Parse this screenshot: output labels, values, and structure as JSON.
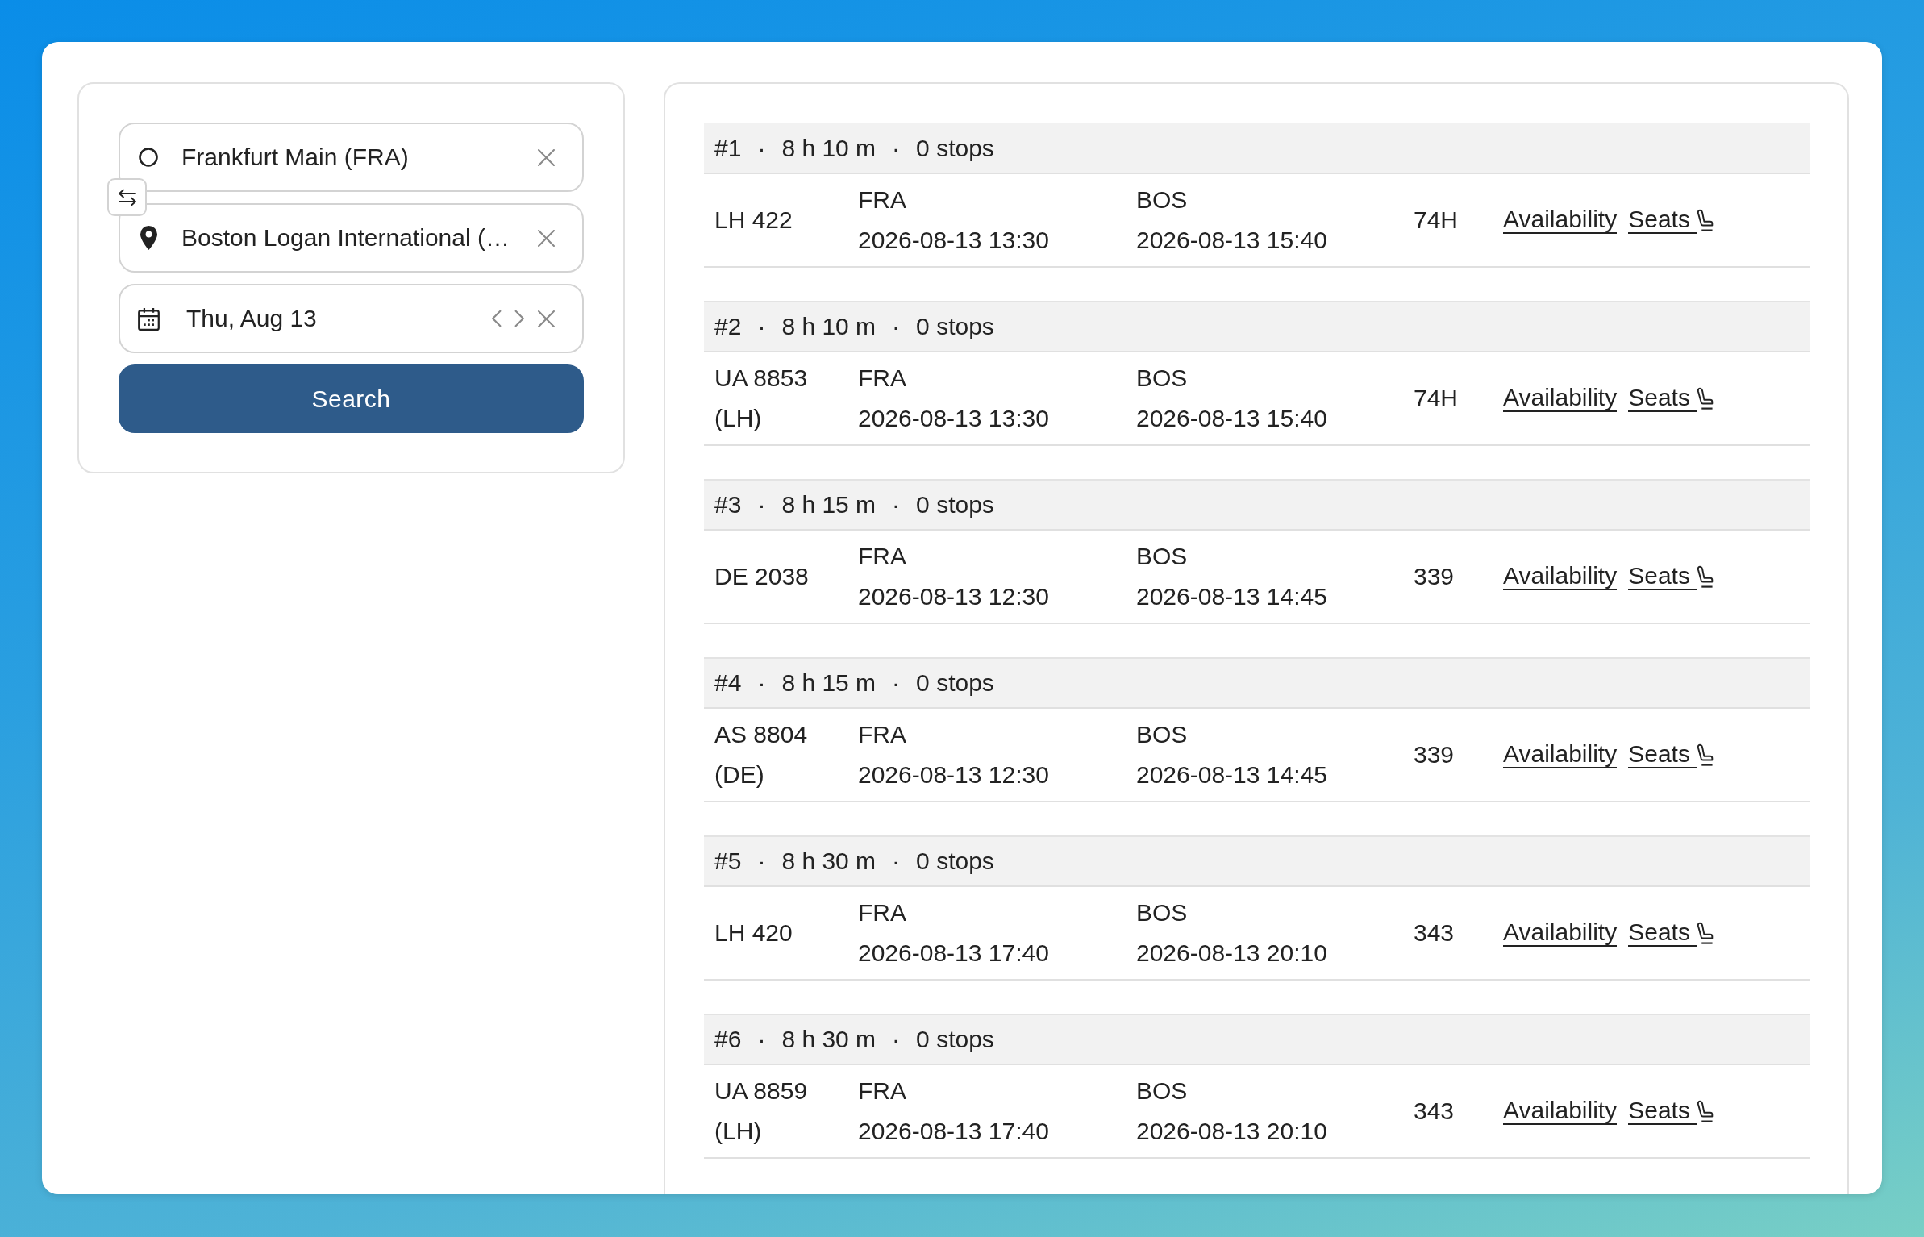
{
  "search_form": {
    "origin": {
      "value": "Frankfurt Main (FRA)"
    },
    "destination": {
      "value": "Boston Logan International (…"
    },
    "date": {
      "value": "Thu, Aug 13"
    },
    "search_button": "Search"
  },
  "results": [
    {
      "summary": [
        "#1",
        "·",
        "8 h 10 m",
        "·",
        "0 stops"
      ],
      "flight": "LH 422",
      "origin": "FRA",
      "departure": "2026-08-13 13:30",
      "destination": "BOS",
      "arrival": "2026-08-13 15:40",
      "aircraft": "74H",
      "links": [
        {
          "kind": "availability",
          "label": "Availability"
        },
        {
          "kind": "seats",
          "label": "Seats"
        }
      ]
    },
    {
      "summary": [
        "#2",
        "·",
        "8 h 10 m",
        "·",
        "0 stops"
      ],
      "flight": "UA 8853 (LH)",
      "origin": "FRA",
      "departure": "2026-08-13 13:30",
      "destination": "BOS",
      "arrival": "2026-08-13 15:40",
      "aircraft": "74H",
      "links": [
        {
          "kind": "availability",
          "label": "Availability"
        },
        {
          "kind": "seats",
          "label": "Seats"
        }
      ]
    },
    {
      "summary": [
        "#3",
        "·",
        "8 h 15 m",
        "·",
        "0 stops"
      ],
      "flight": "DE 2038",
      "origin": "FRA",
      "departure": "2026-08-13 12:30",
      "destination": "BOS",
      "arrival": "2026-08-13 14:45",
      "aircraft": "339",
      "links": [
        {
          "kind": "availability",
          "label": "Availability"
        },
        {
          "kind": "seats",
          "label": "Seats"
        }
      ]
    },
    {
      "summary": [
        "#4",
        "·",
        "8 h 15 m",
        "·",
        "0 stops"
      ],
      "flight": "AS 8804 (DE)",
      "origin": "FRA",
      "departure": "2026-08-13 12:30",
      "destination": "BOS",
      "arrival": "2026-08-13 14:45",
      "aircraft": "339",
      "links": [
        {
          "kind": "availability",
          "label": "Availability"
        },
        {
          "kind": "seats",
          "label": "Seats"
        }
      ]
    },
    {
      "summary": [
        "#5",
        "·",
        "8 h 30 m",
        "·",
        "0 stops"
      ],
      "flight": "LH 420",
      "origin": "FRA",
      "departure": "2026-08-13 17:40",
      "destination": "BOS",
      "arrival": "2026-08-13 20:10",
      "aircraft": "343",
      "links": [
        {
          "kind": "availability",
          "label": "Availability"
        },
        {
          "kind": "seats",
          "label": "Seats"
        }
      ]
    },
    {
      "summary": [
        "#6",
        "·",
        "8 h 30 m",
        "·",
        "0 stops"
      ],
      "flight": "UA 8859 (LH)",
      "origin": "FRA",
      "departure": "2026-08-13 17:40",
      "destination": "BOS",
      "arrival": "2026-08-13 20:10",
      "aircraft": "343",
      "links": [
        {
          "kind": "availability",
          "label": "Availability"
        },
        {
          "kind": "seats",
          "label": "Seats"
        }
      ]
    }
  ]
}
